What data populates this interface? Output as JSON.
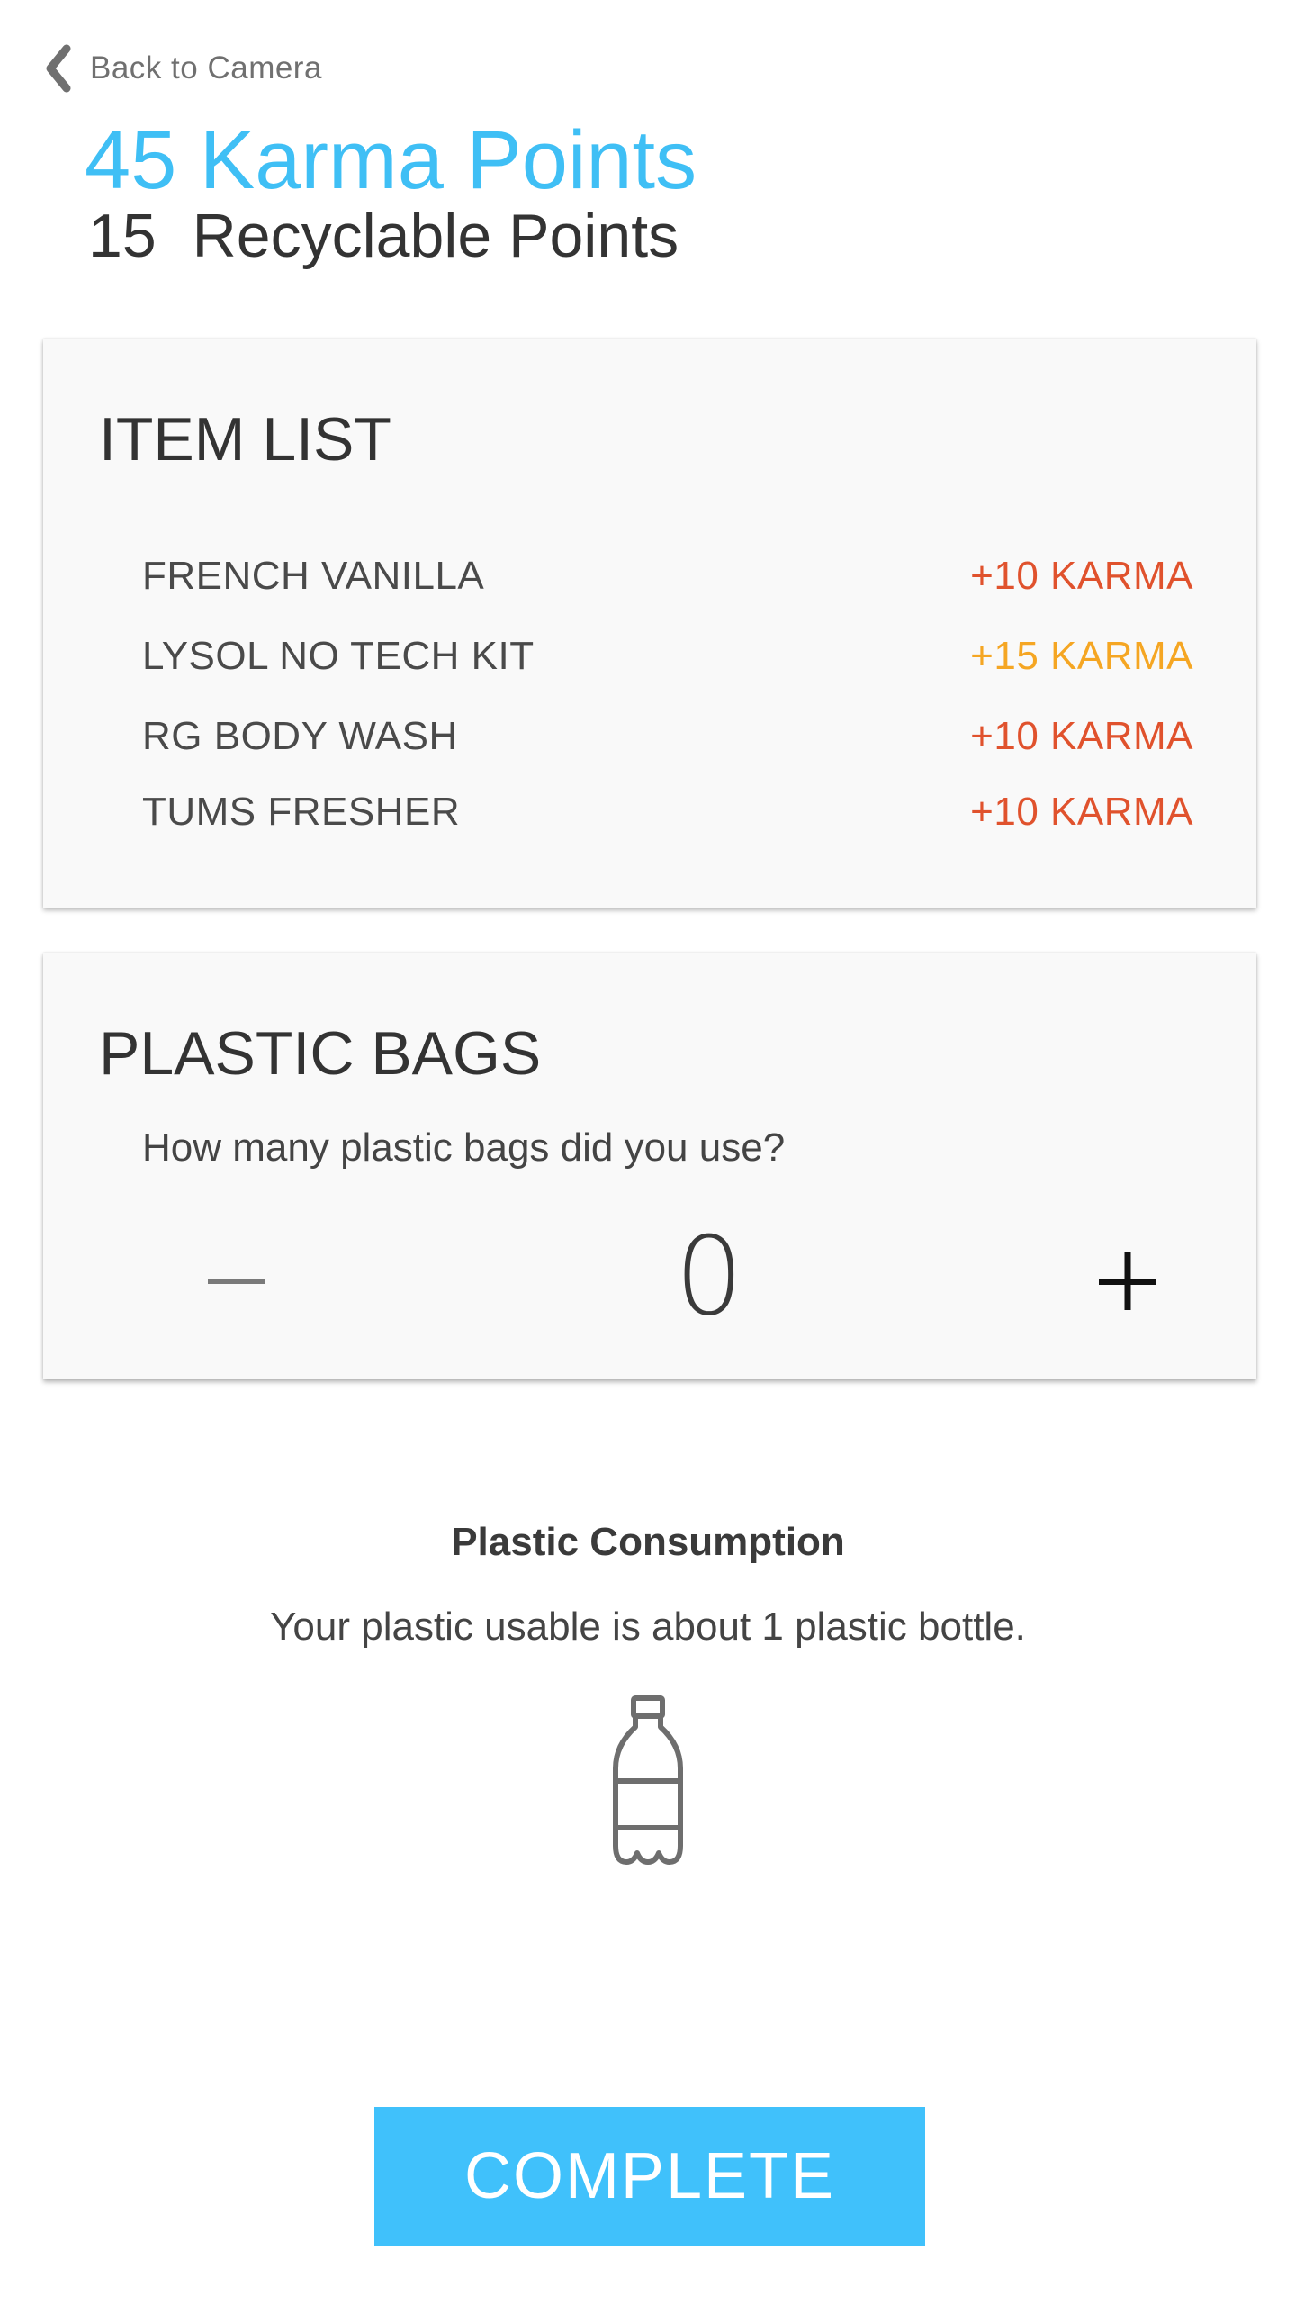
{
  "header": {
    "back_label": "Back to Camera",
    "karma_title": "45 Karma Points",
    "recyclable_number": "15",
    "recyclable_label": "Recyclable Points"
  },
  "item_list": {
    "heading": "ITEM LIST",
    "items": [
      {
        "name": "FRENCH VANILLA",
        "karma": "+10 KARMA",
        "karma_color": "#e0522d"
      },
      {
        "name": "LYSOL NO TECH KIT",
        "karma": "+15 KARMA",
        "karma_color": "#f5a623"
      },
      {
        "name": "RG BODY WASH",
        "karma": "+10 KARMA",
        "karma_color": "#e0522d"
      },
      {
        "name": "TUMS FRESHER",
        "karma": "+10 KARMA",
        "karma_color": "#e0522d"
      }
    ]
  },
  "plastic_bags": {
    "heading": "PLASTIC BAGS",
    "question": "How many plastic bags did you use?",
    "count": "0",
    "decrement_icon": "minus-icon",
    "increment_icon": "plus-icon"
  },
  "consumption": {
    "title": "Plastic Consumption",
    "text": "Your plastic usable is about 1 plastic bottle.",
    "icon": "plastic-bottle-icon"
  },
  "complete_label": "COMPLETE",
  "colors": {
    "accent": "#40c1fb",
    "title_blue": "#3fbff5",
    "karma_red": "#e0522d",
    "karma_orange": "#f5a623"
  }
}
